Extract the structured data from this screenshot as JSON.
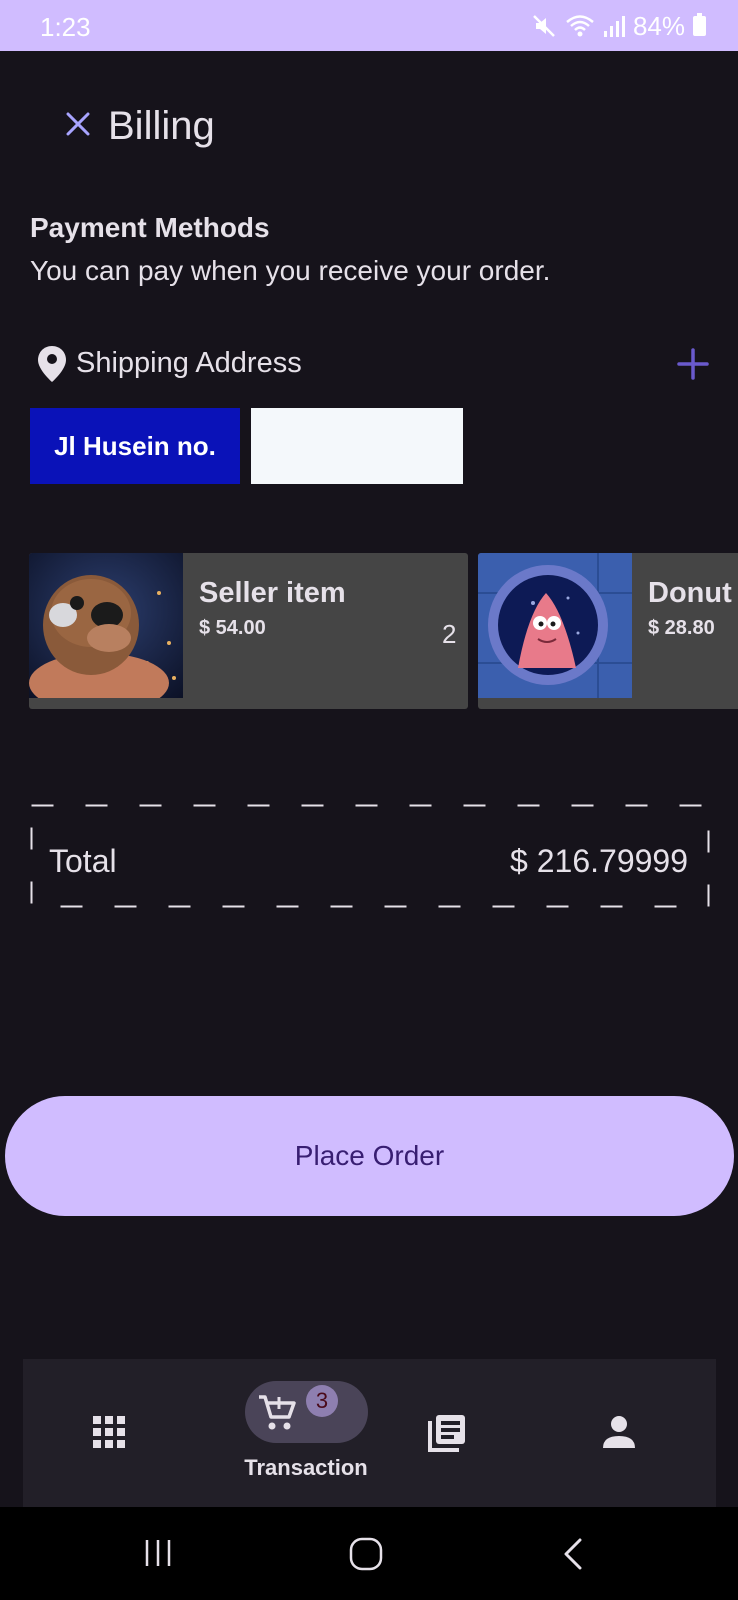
{
  "status_bar": {
    "time": "1:23",
    "battery": "84%",
    "icons": [
      "mute-icon",
      "wifi-icon",
      "signal-icon",
      "battery-icon"
    ]
  },
  "header": {
    "title": "Billing",
    "close_icon": "close-icon"
  },
  "payment": {
    "heading": "Payment Methods",
    "description": "You can pay when you receive your order."
  },
  "shipping": {
    "label": "Shipping Address",
    "addresses": [
      "Jl Husein no.",
      ""
    ]
  },
  "items": [
    {
      "name": "Seller item",
      "price": "$ 54.00",
      "qty": "2"
    },
    {
      "name": "Donut",
      "price": "$ 28.80",
      "qty": ""
    }
  ],
  "total": {
    "label": "Total",
    "value": "$ 216.79999"
  },
  "actions": {
    "place_order": "Place Order"
  },
  "bottom_nav": {
    "items": [
      {
        "icon": "apps-grid-icon",
        "label": ""
      },
      {
        "icon": "cart-icon",
        "label": "Transaction",
        "badge": "3",
        "active": true
      },
      {
        "icon": "library-icon",
        "label": ""
      },
      {
        "icon": "person-icon",
        "label": ""
      }
    ]
  },
  "colors": {
    "background": "#16131b",
    "accent": "#d0bcff",
    "on_accent": "#381e72",
    "address_chip": "#0a12b8",
    "card": "#454545"
  }
}
